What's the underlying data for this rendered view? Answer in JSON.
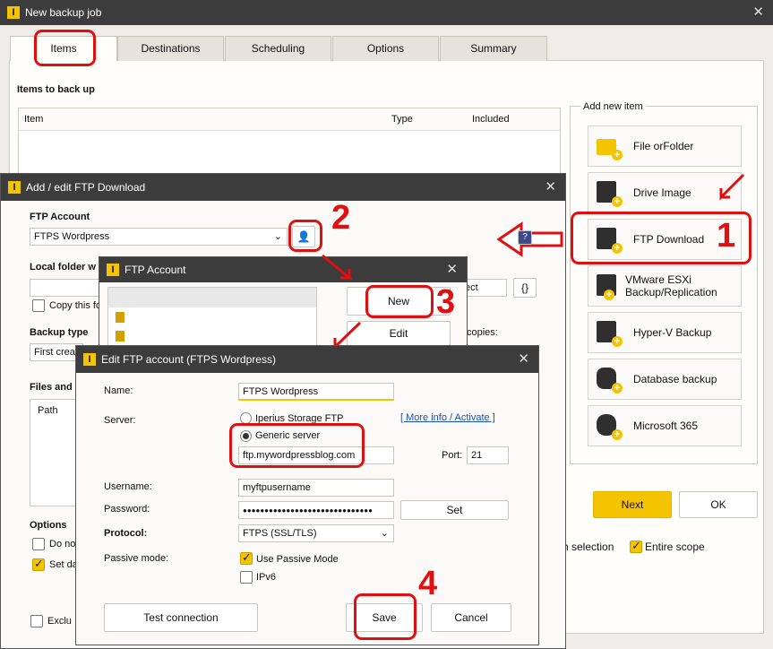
{
  "main_window": {
    "title": "New backup job",
    "tabs": [
      "Items",
      "Destinations",
      "Scheduling",
      "Options",
      "Summary"
    ],
    "items_heading": "Items to back up",
    "columns": [
      "Item",
      "Type",
      "Included"
    ],
    "add_new_item_label": "Add new item",
    "add_items": [
      "File orFolder",
      "Drive Image",
      "FTP Download",
      "VMware ESXi Backup/Replication",
      "Hyper-V Backup",
      "Database backup",
      "Microsoft 365"
    ],
    "next_label": "Next",
    "ok_label": "OK",
    "bottom_right_text": "ch selection",
    "entire_scope_label": "Entire scope"
  },
  "ftp_download_dialog": {
    "title": "Add / edit FTP Download",
    "ftp_account_label": "FTP Account",
    "ftp_account_value": "FTPS Wordpress",
    "local_folder_label": "Local folder w",
    "copy_label": "Copy this fo",
    "backup_type_label": "Backup type",
    "backup_type_value": "First crea",
    "files_label": "Files and",
    "path_label": "Path",
    "options_label": "Options",
    "do_not_label": "Do no",
    "set_date_label": "Set da",
    "exclude_label": "Exclu",
    "copies_label": "copies:",
    "ect_label": "ect",
    "braces_label": "{}"
  },
  "ftp_account_dialog": {
    "title": "FTP Account",
    "new_label": "New",
    "edit_label": "Edit"
  },
  "edit_dialog": {
    "title": "Edit FTP account (FTPS Wordpress)",
    "name_label": "Name:",
    "name_value": "FTPS Wordpress",
    "server_label": "Server:",
    "iperius_storage_label": "Iperius Storage FTP",
    "more_info_label": "[ More info / Activate ]",
    "generic_server_label": "Generic server",
    "server_value": "ftp.mywordpressblog.com",
    "port_label": "Port:",
    "port_value": "21",
    "username_label": "Username:",
    "username_value": "myftpusername",
    "password_label": "Password:",
    "password_value": "●●●●●●●●●●●●●●●●●●●●●●●●●●●●●●",
    "set_label": "Set",
    "protocol_label": "Protocol:",
    "protocol_value": "FTPS (SSL/TLS)",
    "passive_mode_label": "Passive mode:",
    "use_passive_label": "Use Passive Mode",
    "ipv6_label": "IPv6",
    "test_connection_label": "Test connection",
    "save_label": "Save",
    "cancel_label": "Cancel"
  },
  "annotations": {
    "n1": "1",
    "n2": "2",
    "n3": "3",
    "n4": "4"
  },
  "colors": {
    "accent": "#f5c400",
    "red": "#e01010",
    "titlebar": "#3c3c3c"
  }
}
